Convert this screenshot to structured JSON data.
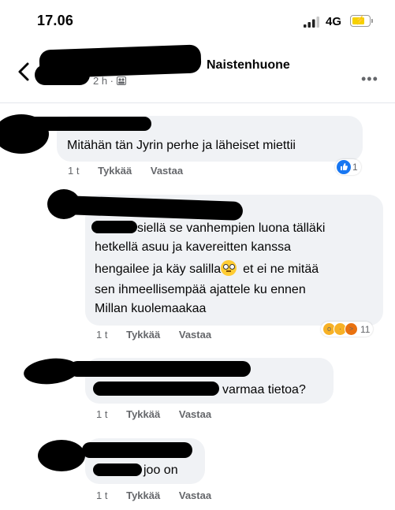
{
  "status_bar": {
    "time": "17.06",
    "network": "4G"
  },
  "header": {
    "group_name": "Naistenhuone",
    "time_ago": "2 h ·",
    "more": "•••"
  },
  "comments": [
    {
      "text_lines": [
        "Mitähän tän Jyrin perhe ja läheiset miettii"
      ],
      "time": "1 t",
      "like": "Tykkää",
      "reply": "Vastaa",
      "reactions": {
        "count": "1"
      }
    },
    {
      "text_lines": [
        "siellä se vanhempien luona tälläki",
        "hetkellä asuu ja kavereitten kanssa",
        "hengailee ja käy salilla",
        "sen ihmeellisempää ajattele ku ennen",
        "Millan kuolemaakaa"
      ],
      "inline_tail": "et ei ne mitää",
      "time": "1 t",
      "like": "Tykkää",
      "reply": "Vastaa",
      "reactions": {
        "count": "11"
      }
    },
    {
      "text_lines": [
        "varmaa tietoa?"
      ],
      "time": "1 t",
      "like": "Tykkää",
      "reply": "Vastaa"
    },
    {
      "text_lines": [
        "joo on"
      ],
      "time": "1 t",
      "like": "Tykkää",
      "reply": "Vastaa"
    }
  ],
  "colors": {
    "bubble": "#f0f2f5",
    "like_blue": "#1877f2",
    "meta_gray": "#65676b"
  }
}
